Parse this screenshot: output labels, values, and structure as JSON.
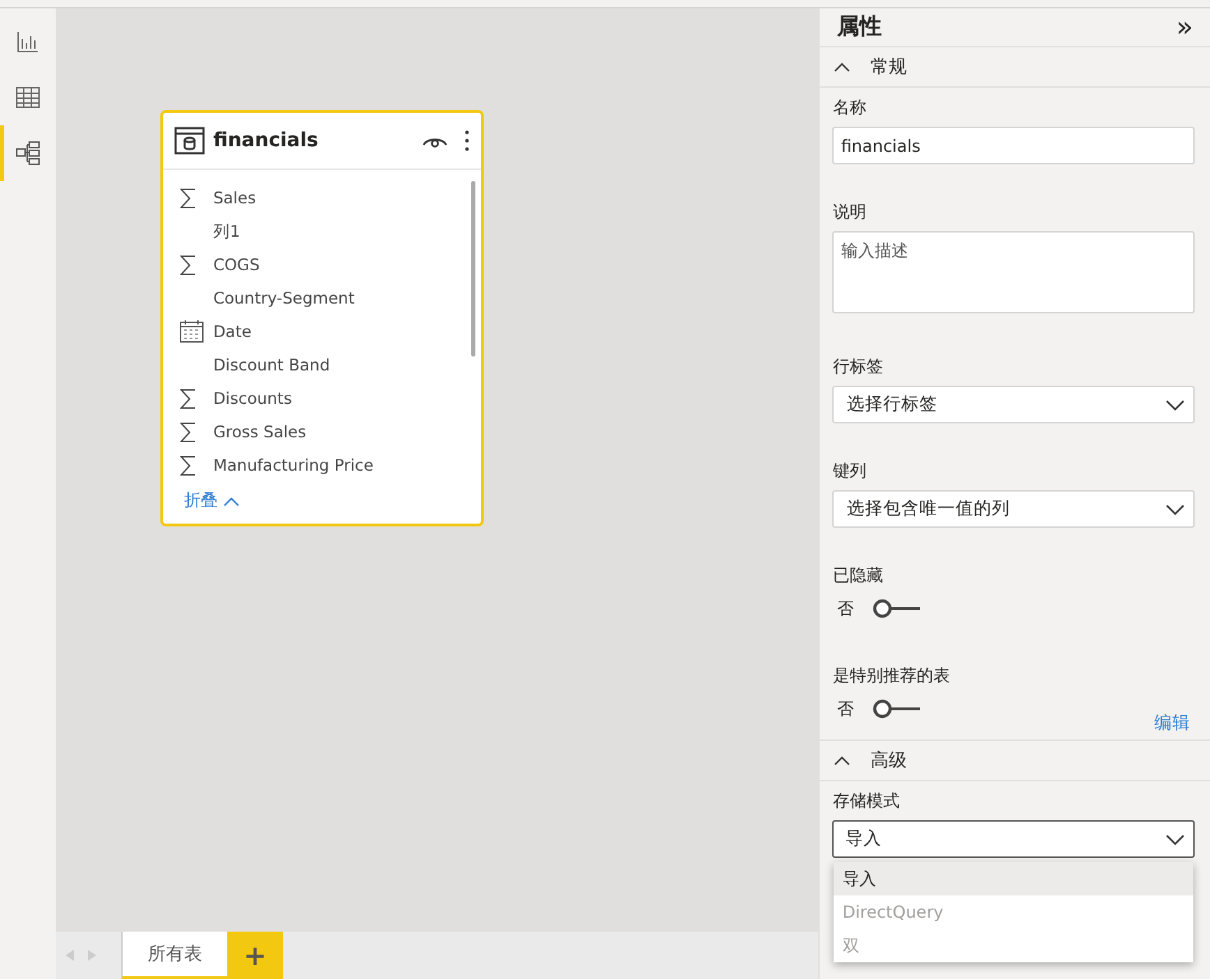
{
  "sidebar": {
    "items": [
      {
        "kind": "report",
        "selected": false
      },
      {
        "kind": "data",
        "selected": false
      },
      {
        "kind": "model",
        "selected": true
      }
    ]
  },
  "table_card": {
    "title": "financials",
    "fields": [
      {
        "name": "Sales",
        "kind": "sum"
      },
      {
        "name": "列1",
        "kind": "text"
      },
      {
        "name": "COGS",
        "kind": "sum"
      },
      {
        "name": "Country-Segment",
        "kind": "text"
      },
      {
        "name": "Date",
        "kind": "date"
      },
      {
        "name": "Discount Band",
        "kind": "text"
      },
      {
        "name": "Discounts",
        "kind": "sum"
      },
      {
        "name": "Gross Sales",
        "kind": "sum"
      },
      {
        "name": "Manufacturing Price",
        "kind": "sum"
      }
    ],
    "collapse_link": "折叠"
  },
  "page_tabs": {
    "tabs": [
      {
        "label": "所有表",
        "selected": true
      }
    ],
    "add_button": "+"
  },
  "properties": {
    "title": "属性",
    "collapse_icon": "»",
    "general": {
      "header": "常规",
      "expanded": true,
      "name_label": "名称",
      "name_value": "financials",
      "description_label": "说明",
      "description_placeholder": "输入描述",
      "row_label_label": "行标签",
      "row_label_placeholder": "选择行标签",
      "key_column_label": "键列",
      "key_column_placeholder": "选择包含唯一值的列",
      "hidden_label": "已隐藏",
      "hidden_state": "否",
      "hidden_on": false,
      "featured_label": "是特别推荐的表",
      "featured_state": "否",
      "featured_on": false,
      "edit_link": "编辑"
    },
    "advanced": {
      "header": "高级",
      "expanded": true,
      "storage_mode_label": "存储模式",
      "storage_mode_value": "导入",
      "options": [
        {
          "label": "导入",
          "selected": true,
          "disabled": false
        },
        {
          "label": "DirectQuery",
          "selected": false,
          "disabled": true
        },
        {
          "label": "双",
          "selected": false,
          "disabled": true
        }
      ]
    }
  }
}
